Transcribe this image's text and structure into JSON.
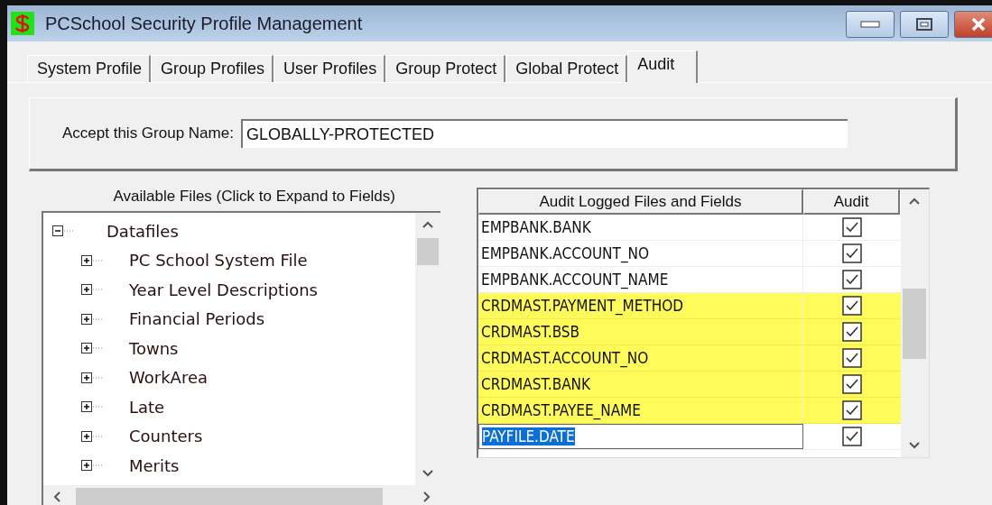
{
  "window": {
    "title": "PCSchool Security Profile Management"
  },
  "tabs": [
    {
      "label": "System Profile",
      "selected": false
    },
    {
      "label": "Group Profiles",
      "selected": false
    },
    {
      "label": "User Profiles",
      "selected": false
    },
    {
      "label": "Group Protect",
      "selected": false
    },
    {
      "label": "Global Protect",
      "selected": false
    },
    {
      "label": "Audit",
      "selected": true
    }
  ],
  "group_name": {
    "label": "Accept this Group Name:",
    "value": "GLOBALLY-PROTECTED"
  },
  "tree": {
    "heading": "Available Files (Click to Expand to Fields)",
    "items": [
      {
        "label": "Datafiles",
        "expanded": true,
        "children": [
          {
            "label": "PC School System File",
            "expanded": false
          },
          {
            "label": "Year Level Descriptions",
            "expanded": false
          },
          {
            "label": "Financial Periods",
            "expanded": false
          },
          {
            "label": "Towns",
            "expanded": false
          },
          {
            "label": "WorkArea",
            "expanded": false
          },
          {
            "label": "Late",
            "expanded": false
          },
          {
            "label": "Counters",
            "expanded": false
          },
          {
            "label": "Merits",
            "expanded": false
          }
        ]
      }
    ]
  },
  "grid": {
    "columns": [
      "Audit Logged Files and Fields",
      "Audit"
    ],
    "rows": [
      {
        "field": "EMPBANK.BANK",
        "checked": true,
        "highlighted": false,
        "editing": false
      },
      {
        "field": "EMPBANK.ACCOUNT_NO",
        "checked": true,
        "highlighted": false,
        "editing": false
      },
      {
        "field": "EMPBANK.ACCOUNT_NAME",
        "checked": true,
        "highlighted": false,
        "editing": false
      },
      {
        "field": "CRDMAST.PAYMENT_METHOD",
        "checked": true,
        "highlighted": true,
        "editing": false
      },
      {
        "field": "CRDMAST.BSB",
        "checked": true,
        "highlighted": true,
        "editing": false
      },
      {
        "field": "CRDMAST.ACCOUNT_NO",
        "checked": true,
        "highlighted": true,
        "editing": false
      },
      {
        "field": "CRDMAST.BANK",
        "checked": true,
        "highlighted": true,
        "editing": false
      },
      {
        "field": "CRDMAST.PAYEE_NAME",
        "checked": true,
        "highlighted": true,
        "editing": false
      },
      {
        "field": "PAYFILE.DATE",
        "checked": true,
        "highlighted": false,
        "editing": true
      }
    ]
  }
}
